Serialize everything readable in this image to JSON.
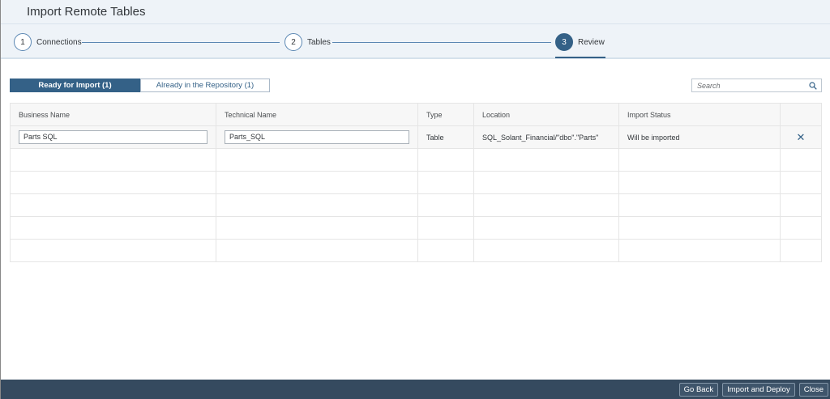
{
  "title": "Import Remote Tables",
  "steps": [
    {
      "num": "1",
      "label": "Connections"
    },
    {
      "num": "2",
      "label": "Tables"
    },
    {
      "num": "3",
      "label": "Review"
    }
  ],
  "segments": {
    "ready": "Ready for Import (1)",
    "already": "Already in the Repository (1)"
  },
  "search": {
    "placeholder": "Search"
  },
  "table": {
    "headers": [
      "Business Name",
      "Technical Name",
      "Type",
      "Location",
      "Import Status"
    ],
    "rows": [
      {
        "business_name": "Parts SQL",
        "technical_name": "Parts_SQL",
        "type": "Table",
        "location": "SQL_Solant_Financial/\"dbo\".\"Parts\"",
        "status": "Will be imported"
      }
    ]
  },
  "footer": {
    "go_back": "Go Back",
    "import_deploy": "Import and Deploy",
    "close": "Close"
  }
}
